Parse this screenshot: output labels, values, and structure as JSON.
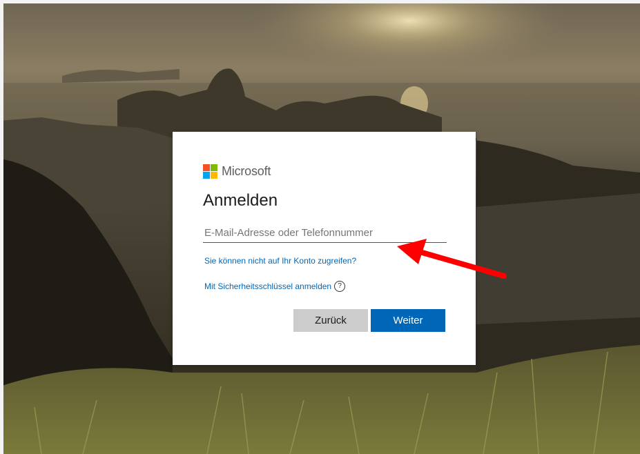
{
  "brand": {
    "logo_text": "Microsoft",
    "logo_colors": [
      "#f25022",
      "#7fba00",
      "#00a4ef",
      "#ffb900"
    ]
  },
  "card": {
    "title": "Anmelden",
    "email_placeholder": "E-Mail-Adresse oder Telefonnummer",
    "email_value": "",
    "link_cant_access": "Sie können nicht auf Ihr Konto zugreifen?",
    "link_security_key": "Mit Sicherheitsschlüssel anmelden",
    "help_icon": "question-circle-icon",
    "back_label": "Zurück",
    "next_label": "Weiter"
  },
  "colors": {
    "accent": "#0067b8",
    "back_button": "#cccccc",
    "annotation_arrow": "#ff0000"
  }
}
